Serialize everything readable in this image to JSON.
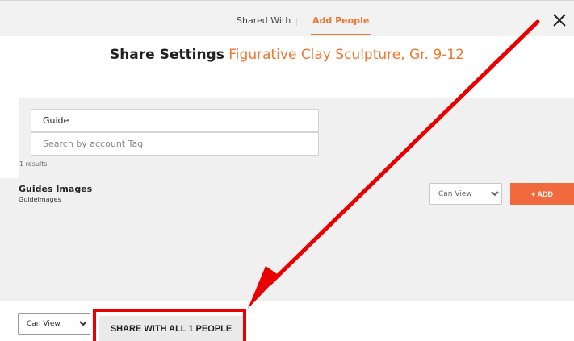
{
  "tabs": [
    {
      "label": "Shared With",
      "active": false
    },
    {
      "label": "Add People",
      "active": true
    }
  ],
  "header": {
    "title_label": "Share Settings",
    "title_name": "Figurative Clay Sculpture, Gr. 9-12"
  },
  "search": {
    "guide_value": "Guide",
    "tag_placeholder": "Search by account Tag",
    "results_text": "1 results"
  },
  "result": {
    "name": "Guides Images",
    "sub": "GuideImages",
    "permission": "Can View",
    "add_label": "+ ADD"
  },
  "footer": {
    "permission": "Can View",
    "share_label": "SHARE WITH ALL 1 PEOPLE"
  },
  "permission_options": [
    "Can View"
  ],
  "colors": {
    "accent": "#ee7830",
    "add_button": "#f06a3d",
    "annotation": "#ea0000"
  },
  "icons": {
    "close": "close-icon",
    "dropdown": "chevron-down-icon",
    "annotation": "red-arrow-annotation"
  }
}
